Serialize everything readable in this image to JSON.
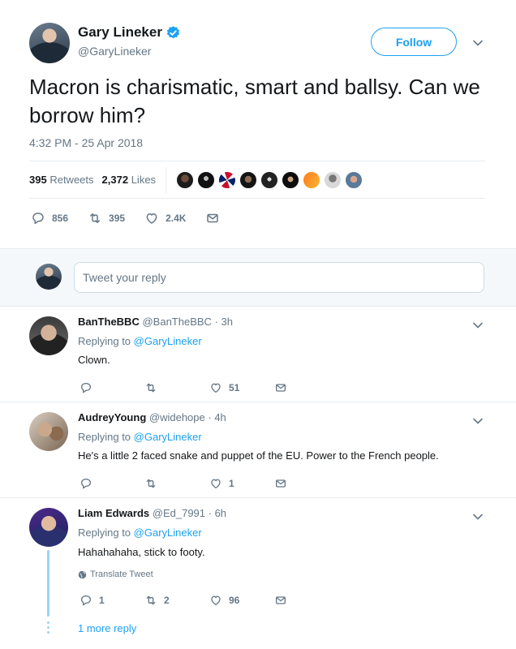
{
  "tweet": {
    "author_name": "Gary Lineker",
    "author_handle": "@GaryLineker",
    "follow_label": "Follow",
    "text": "Macron is charismatic, smart and ballsy. Can we borrow him?",
    "timestamp": "4:32 PM - 25 Apr 2018",
    "retweets_count": "395",
    "retweets_label": "Retweets",
    "likes_count": "2,372",
    "likes_label": "Likes",
    "actions": {
      "replies": "856",
      "retweets": "395",
      "likes": "2.4K"
    }
  },
  "reply_box": {
    "placeholder": "Tweet your reply"
  },
  "replies": [
    {
      "name": "BanTheBBC",
      "handle": "@BanTheBBC",
      "time": "· 3h",
      "replying_prefix": "Replying to",
      "replying_to": "@GaryLineker",
      "text": "Clown.",
      "reply_count": "",
      "retweet_count": "",
      "like_count": "51"
    },
    {
      "name": "AudreyYoung",
      "handle": "@widehope",
      "time": "· 4h",
      "replying_prefix": "Replying to",
      "replying_to": "@GaryLineker",
      "text": "He's a little 2 faced snake and puppet of the EU. Power to the French people.",
      "reply_count": "",
      "retweet_count": "",
      "like_count": "1"
    },
    {
      "name": "Liam Edwards",
      "handle": "@Ed_7991",
      "time": "· 6h",
      "replying_prefix": "Replying to",
      "replying_to": "@GaryLineker",
      "text": "Hahahahaha, stick to footy.",
      "translate_label": "Translate Tweet",
      "reply_count": "1",
      "retweet_count": "2",
      "like_count": "96",
      "more_replies_label": "1 more reply"
    }
  ],
  "colors": {
    "accent": "#1da1f2",
    "secondary_text": "#657786",
    "primary_text": "#14171a",
    "divider": "#e6ecf0"
  }
}
